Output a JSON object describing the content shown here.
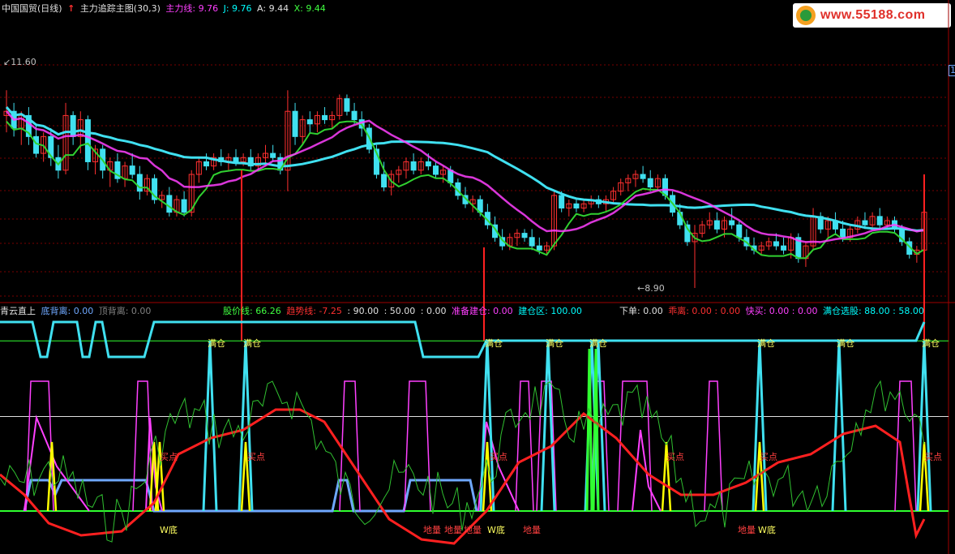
{
  "header": {
    "stock": "中国国贸(日线)",
    "indicator_name": "主力追踪主图(30,3)",
    "fields": [
      {
        "label": "主力线: 9.76",
        "color": "magenta"
      },
      {
        "label": "J: 9.76",
        "color": "cyan"
      },
      {
        "label": "A: 9.44",
        "color": "white"
      },
      {
        "label": "X: 9.44",
        "color": "lgreen"
      }
    ]
  },
  "logo": {
    "text": "www.55188.com"
  },
  "main_chart": {
    "high_label": "11.60",
    "low_label": "8.90",
    "right_marker": "1"
  },
  "sub_header": {
    "name": "青云直上",
    "items": [
      {
        "label": "底背离: 0.00",
        "color": "blue"
      },
      {
        "label": "顶背离: 0.00",
        "color": "gray"
      }
    ],
    "items2": [
      {
        "label": "股价线: 66.26",
        "color": "lgreen"
      },
      {
        "label": "趋势线: -7.25",
        "color": "red"
      },
      {
        "label": ": 90.00",
        "color": "white"
      },
      {
        "label": ": 50.00",
        "color": "white"
      },
      {
        "label": ": 0.00",
        "color": "white"
      },
      {
        "label": "准备建仓: 0.00",
        "color": "magenta"
      },
      {
        "label": "建仓区: 100.00",
        "color": "cyan"
      },
      {
        "label": "下单: 0.00",
        "color": "white"
      },
      {
        "label": "乖离: 0.00 : 0.00",
        "color": "red"
      },
      {
        "label": "快买: 0.00 : 0.00",
        "color": "magenta"
      },
      {
        "label": "满仓选股: 88.00 : 58.00",
        "color": "cyan"
      }
    ]
  },
  "annotations": {
    "full": "满仓",
    "buy": "买点",
    "wbottom": "W底",
    "ground": "地量"
  },
  "chart_data": {
    "type": "candlestick",
    "price_range": [
      8.9,
      11.6
    ],
    "candles": [
      [
        10.95,
        11.25,
        10.75,
        11.0
      ],
      [
        11.0,
        11.1,
        10.7,
        10.8
      ],
      [
        10.8,
        11.0,
        10.6,
        10.95
      ],
      [
        10.95,
        11.05,
        10.6,
        10.7
      ],
      [
        10.7,
        10.85,
        10.45,
        10.5
      ],
      [
        10.5,
        10.75,
        10.4,
        10.7
      ],
      [
        10.7,
        10.8,
        10.35,
        10.45
      ],
      [
        10.45,
        10.6,
        10.2,
        10.3
      ],
      [
        10.3,
        11.1,
        10.25,
        10.95
      ],
      [
        10.95,
        11.0,
        10.6,
        10.7
      ],
      [
        10.7,
        11.0,
        10.5,
        10.9
      ],
      [
        10.9,
        10.95,
        10.3,
        10.4
      ],
      [
        10.4,
        10.6,
        10.25,
        10.55
      ],
      [
        10.55,
        10.6,
        10.2,
        10.3
      ],
      [
        10.3,
        10.45,
        10.1,
        10.4
      ],
      [
        10.4,
        10.5,
        10.15,
        10.2
      ],
      [
        10.2,
        10.4,
        10.1,
        10.35
      ],
      [
        10.35,
        10.5,
        10.2,
        10.25
      ],
      [
        10.25,
        10.35,
        9.95,
        10.05
      ],
      [
        10.05,
        10.25,
        10.0,
        10.2
      ],
      [
        10.2,
        10.25,
        9.9,
        9.95
      ],
      [
        9.95,
        10.05,
        9.85,
        10.0
      ],
      [
        10.0,
        10.1,
        9.75,
        9.8
      ],
      [
        9.8,
        10.0,
        9.75,
        9.95
      ],
      [
        9.95,
        10.05,
        9.75,
        9.8
      ],
      [
        9.8,
        10.3,
        9.75,
        10.25
      ],
      [
        10.25,
        10.45,
        10.15,
        10.4
      ],
      [
        10.4,
        10.5,
        10.3,
        10.35
      ],
      [
        10.35,
        10.5,
        10.3,
        10.45
      ],
      [
        10.45,
        10.55,
        10.35,
        10.4
      ],
      [
        10.4,
        10.5,
        10.3,
        10.45
      ],
      [
        10.45,
        10.55,
        10.35,
        10.4
      ],
      [
        10.4,
        10.5,
        10.35,
        10.45
      ],
      [
        10.45,
        10.55,
        10.3,
        10.35
      ],
      [
        10.35,
        10.5,
        10.3,
        10.45
      ],
      [
        10.45,
        10.6,
        10.35,
        10.5
      ],
      [
        10.5,
        10.6,
        10.4,
        10.45
      ],
      [
        10.45,
        10.5,
        10.25,
        10.3
      ],
      [
        10.3,
        11.25,
        10.05,
        11.0
      ],
      [
        11.0,
        11.1,
        10.6,
        10.7
      ],
      [
        10.7,
        10.95,
        10.6,
        10.9
      ],
      [
        10.9,
        11.0,
        10.75,
        10.85
      ],
      [
        10.85,
        11.0,
        10.75,
        10.95
      ],
      [
        10.95,
        11.05,
        10.85,
        10.9
      ],
      [
        10.9,
        11.0,
        10.8,
        10.95
      ],
      [
        10.95,
        11.2,
        10.9,
        11.15
      ],
      [
        11.15,
        11.2,
        10.95,
        11.0
      ],
      [
        11.0,
        11.1,
        10.85,
        10.9
      ],
      [
        10.9,
        11.0,
        10.7,
        10.8
      ],
      [
        10.8,
        10.85,
        10.5,
        10.55
      ],
      [
        10.55,
        10.6,
        10.2,
        10.25
      ],
      [
        10.25,
        10.4,
        10.05,
        10.1
      ],
      [
        10.1,
        10.3,
        10.0,
        10.25
      ],
      [
        10.25,
        10.35,
        10.15,
        10.3
      ],
      [
        10.3,
        10.45,
        10.2,
        10.4
      ],
      [
        10.4,
        10.5,
        10.25,
        10.3
      ],
      [
        10.3,
        10.45,
        10.25,
        10.4
      ],
      [
        10.4,
        10.5,
        10.3,
        10.35
      ],
      [
        10.35,
        10.4,
        10.2,
        10.25
      ],
      [
        10.25,
        10.35,
        10.15,
        10.3
      ],
      [
        10.3,
        10.35,
        10.1,
        10.15
      ],
      [
        10.15,
        10.2,
        9.95,
        10.0
      ],
      [
        10.0,
        10.1,
        9.85,
        9.9
      ],
      [
        9.9,
        10.0,
        9.8,
        9.95
      ],
      [
        9.95,
        10.0,
        9.75,
        9.8
      ],
      [
        9.8,
        9.9,
        9.6,
        9.65
      ],
      [
        9.65,
        9.75,
        9.45,
        9.5
      ],
      [
        9.5,
        9.6,
        9.35,
        9.4
      ],
      [
        9.4,
        9.55,
        9.35,
        9.5
      ],
      [
        9.5,
        9.6,
        9.4,
        9.55
      ],
      [
        9.55,
        9.6,
        9.45,
        9.5
      ],
      [
        9.5,
        9.6,
        9.35,
        9.4
      ],
      [
        9.4,
        9.5,
        9.3,
        9.35
      ],
      [
        9.35,
        9.45,
        9.3,
        9.4
      ],
      [
        9.4,
        10.05,
        9.35,
        10.0
      ],
      [
        10.0,
        10.05,
        9.8,
        9.85
      ],
      [
        9.85,
        9.95,
        9.75,
        9.9
      ],
      [
        9.9,
        9.95,
        9.8,
        9.85
      ],
      [
        9.85,
        9.95,
        9.8,
        9.9
      ],
      [
        9.9,
        10.0,
        9.85,
        9.95
      ],
      [
        9.95,
        10.0,
        9.85,
        9.9
      ],
      [
        9.9,
        10.0,
        9.8,
        9.95
      ],
      [
        9.95,
        10.1,
        9.9,
        10.05
      ],
      [
        10.05,
        10.2,
        10.0,
        10.15
      ],
      [
        10.15,
        10.25,
        10.05,
        10.2
      ],
      [
        10.2,
        10.3,
        10.1,
        10.25
      ],
      [
        10.25,
        10.35,
        10.15,
        10.2
      ],
      [
        10.2,
        10.3,
        10.05,
        10.1
      ],
      [
        10.1,
        10.25,
        10.05,
        10.2
      ],
      [
        10.2,
        10.25,
        9.95,
        10.0
      ],
      [
        10.0,
        10.05,
        9.75,
        9.8
      ],
      [
        9.8,
        9.9,
        9.6,
        9.65
      ],
      [
        9.65,
        9.7,
        9.4,
        9.45
      ],
      [
        9.45,
        9.65,
        8.9,
        9.55
      ],
      [
        9.55,
        9.7,
        9.5,
        9.65
      ],
      [
        9.65,
        9.8,
        9.6,
        9.7
      ],
      [
        9.7,
        9.8,
        9.55,
        9.6
      ],
      [
        9.6,
        9.75,
        9.5,
        9.7
      ],
      [
        9.7,
        9.85,
        9.6,
        9.65
      ],
      [
        9.65,
        9.7,
        9.45,
        9.5
      ],
      [
        9.5,
        9.6,
        9.35,
        9.4
      ],
      [
        9.4,
        9.5,
        9.3,
        9.35
      ],
      [
        9.35,
        9.45,
        9.3,
        9.4
      ],
      [
        9.4,
        9.5,
        9.35,
        9.45
      ],
      [
        9.45,
        9.55,
        9.35,
        9.4
      ],
      [
        9.4,
        9.5,
        9.3,
        9.35
      ],
      [
        9.35,
        9.55,
        9.25,
        9.5
      ],
      [
        9.5,
        9.55,
        9.2,
        9.25
      ],
      [
        9.25,
        9.45,
        9.15,
        9.4
      ],
      [
        9.4,
        9.85,
        9.35,
        9.75
      ],
      [
        9.75,
        9.8,
        9.55,
        9.6
      ],
      [
        9.6,
        9.75,
        9.5,
        9.7
      ],
      [
        9.7,
        9.8,
        9.55,
        9.6
      ],
      [
        9.6,
        9.7,
        9.45,
        9.5
      ],
      [
        9.5,
        9.65,
        9.45,
        9.6
      ],
      [
        9.6,
        9.75,
        9.55,
        9.7
      ],
      [
        9.7,
        9.8,
        9.6,
        9.65
      ],
      [
        9.65,
        9.8,
        9.6,
        9.75
      ],
      [
        9.75,
        9.85,
        9.6,
        9.65
      ],
      [
        9.65,
        9.75,
        9.6,
        9.7
      ],
      [
        9.7,
        9.75,
        9.55,
        9.6
      ],
      [
        9.6,
        9.65,
        9.4,
        9.45
      ],
      [
        9.45,
        9.5,
        9.25,
        9.3
      ],
      [
        9.3,
        9.4,
        9.2,
        9.35
      ],
      [
        9.35,
        9.85,
        9.3,
        9.8
      ]
    ],
    "series": [
      {
        "name": "主力线",
        "color": "#ff40ff"
      },
      {
        "name": "J",
        "color": "#00ffff"
      },
      {
        "name": "A",
        "color": "#ffff00"
      },
      {
        "name": "X",
        "color": "#40ff40"
      }
    ],
    "sub_levels": [
      100,
      90,
      50,
      0
    ]
  }
}
